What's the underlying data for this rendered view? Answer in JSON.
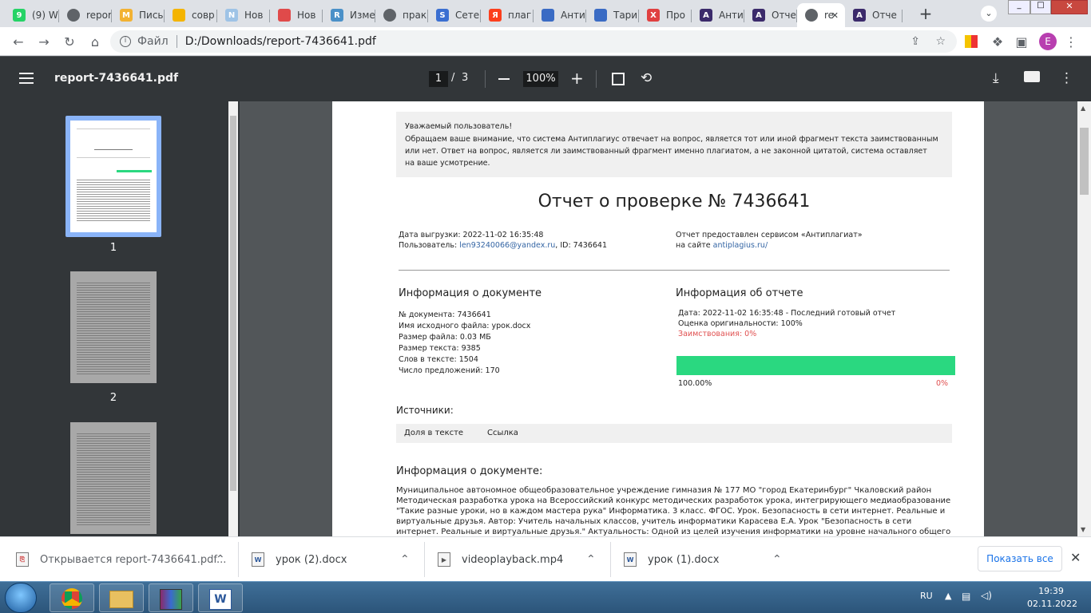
{
  "tabs": [
    {
      "label": "(9) W",
      "fav": "9",
      "color": "#25d366"
    },
    {
      "label": "repor",
      "fav": "globe",
      "color": "#5f6368"
    },
    {
      "label": "Пись",
      "fav": "M",
      "color": "#f2b233"
    },
    {
      "label": "совр",
      "fav": "img",
      "color": "#f4b400"
    },
    {
      "label": "Нов",
      "fav": "N",
      "color": "#9ec3e6"
    },
    {
      "label": "Нов",
      "fav": "edu",
      "color": "#e04a4a"
    },
    {
      "label": "Изме",
      "fav": "R",
      "color": "#4a90c8"
    },
    {
      "label": "прак",
      "fav": "globe",
      "color": "#5f6368"
    },
    {
      "label": "Сете",
      "fav": "S",
      "color": "#3b6fd1"
    },
    {
      "label": "плаг",
      "fav": "Я",
      "color": "#fc3f1d"
    },
    {
      "label": "Анти",
      "fav": "shield",
      "color": "#3a6bc4"
    },
    {
      "label": "Тари",
      "fav": "shield",
      "color": "#3a6bc4"
    },
    {
      "label": "Про",
      "fav": "X",
      "color": "#e04040"
    },
    {
      "label": "Анти",
      "fav": "A",
      "color": "#3b2a6b"
    },
    {
      "label": "Отче",
      "fav": "A",
      "color": "#3b2a6b"
    },
    {
      "label": "re",
      "fav": "globe",
      "color": "#5f6368",
      "active": true
    },
    {
      "label": "Отче",
      "fav": "A",
      "color": "#3b2a6b"
    }
  ],
  "address": {
    "scheme": "Файл",
    "url": "D:/Downloads/report-7436641.pdf"
  },
  "profile_initial": "E",
  "pdf": {
    "filename": "report-7436641.pdf",
    "page_current": "1",
    "page_sep": "/",
    "page_total": "3",
    "zoom": "100%"
  },
  "thumbs": [
    {
      "label": "1"
    },
    {
      "label": "2"
    },
    {
      "label": ""
    }
  ],
  "document": {
    "notice_title": "Уважаемый пользователь!",
    "notice_body": "Обращаем ваше внимание, что система Антиплагиус отвечает на вопрос, является тот или иной фрагмент текста заимствованным или нет. Ответ на вопрос, является ли заимствованный фрагмент именно плагиатом, а не законной цитатой, система оставляет на ваше усмотрение.",
    "title": "Отчет о проверке № 7436641",
    "export_date": "Дата выгрузки: 2022-11-02 16:35:48",
    "user_prefix": "Пользователь: ",
    "user_email": "len93240066@yandex.ru",
    "user_id": ", ID: 7436641",
    "service_line": "Отчет предоставлен сервисом «Антиплагиат»",
    "site_prefix": "на сайте ",
    "site_link": "antiplagius.ru/",
    "doc_info_heading": "Информация о документе",
    "doc_info": [
      "№ документа: 7436641",
      "Имя исходного файла: урок.docx",
      "Размер файла: 0.03 МБ",
      "Размер текста: 9385",
      "Слов в тексте: 1504",
      "Число предложений: 170"
    ],
    "report_heading": "Информация об отчете",
    "report_date": "Дата: 2022-11-02 16:35:48 - Последний готовый отчет",
    "originality": "Оценка оригинальности: 100%",
    "borrowed": "Заимствования: 0%",
    "bar_left": "100.00%",
    "bar_right": "0%",
    "originality_fraction": 1.0,
    "sources_heading": "Источники:",
    "sources_col1": "Доля в тексте",
    "sources_col2": "Ссылка",
    "doc_info2_heading": "Информация о документе:",
    "body_lines": [
      "Муниципальное автономное общеобразовательное учреждение гимназия № 177 МО \"город Екатеринбург\" Чкаловский район",
      "Методическая разработка урока на Всероссийский конкурс методических разработок урока, интегрирующего медиаобразование",
      "\"Такие разные уроки, но в каждом мастера рука\" Информатика. 3 класс. ФГОС. Урок. Безопасность в сети интернет. Реальные и",
      "виртуальные друзья. Автор: Учитель начальных классов, учитель информатики Карасева Е.А. Урок \"Безопасность в сети",
      "интернет. Реальные и виртуальные друзья.\" Актуальность: Одной из целей изучения информатики на уровне начального общего"
    ]
  },
  "downloads": [
    {
      "label": "Открывается report-7436641.pdf...",
      "icon": "pdf"
    },
    {
      "label": "урок (2).docx",
      "icon": "W"
    },
    {
      "label": "videoplayback.mp4",
      "icon": "mp4"
    },
    {
      "label": "урок (1).docx",
      "icon": "W"
    }
  ],
  "show_all": "Показать все",
  "tray": {
    "lang": "RU",
    "time": "19:39",
    "date": "02.11.2022"
  },
  "colors": {
    "progress": "#2ad880",
    "borrowed": "#e05050",
    "link": "#3465a4"
  }
}
